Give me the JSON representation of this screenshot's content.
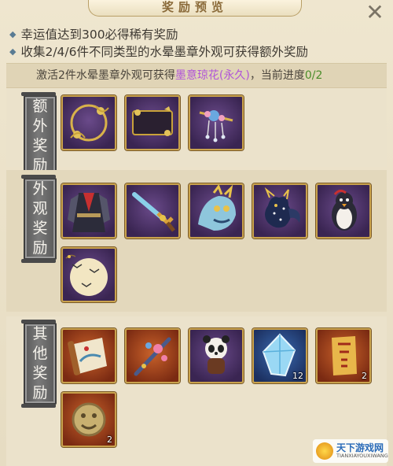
{
  "header": {
    "title": "奖励预览",
    "close_glyph": "✕"
  },
  "rules": [
    {
      "text": "幸运值达到300必得稀有奖励"
    },
    {
      "text": "收集2/4/6件不同类型的水晕墨章外观可获得额外奖励"
    }
  ],
  "progress": {
    "prefix": "激活2件水晕墨章外观可获得",
    "reward_name": "墨意琼花(永久)",
    "middle": "，当前进度",
    "current": "0",
    "separator": "/",
    "target": "2"
  },
  "sections": [
    {
      "label_chars": [
        "额",
        "外",
        "奖",
        "励"
      ],
      "items": [
        {
          "icon": "gold-floral-wreath-frame-icon",
          "bg": "purple"
        },
        {
          "icon": "ornate-gold-nameplate-frame-icon",
          "bg": "purple"
        },
        {
          "icon": "jeweled-hairpin-icon",
          "bg": "purple"
        }
      ]
    },
    {
      "label_chars": [
        "外",
        "观",
        "奖",
        "励"
      ],
      "items": [
        {
          "icon": "dark-robe-costume-icon",
          "bg": "purple"
        },
        {
          "icon": "ornate-sword-weapon-icon",
          "bg": "purple"
        },
        {
          "icon": "blue-gold-qilin-mount-icon",
          "bg": "purple"
        },
        {
          "icon": "starry-spirit-fox-pet-icon",
          "bg": "purple"
        },
        {
          "icon": "penguin-pet-icon",
          "bg": "purple"
        },
        {
          "icon": "moon-and-birds-background-icon",
          "bg": "purple"
        }
      ]
    },
    {
      "label_chars": [
        "其",
        "他",
        "奖",
        "励"
      ],
      "items": [
        {
          "icon": "painting-scroll-icon",
          "bg": "orange",
          "count": ""
        },
        {
          "icon": "flower-sword-icon",
          "bg": "orange",
          "count": ""
        },
        {
          "icon": "panda-companion-icon",
          "bg": "purple",
          "count": ""
        },
        {
          "icon": "blue-crystal-icon",
          "bg": "blue",
          "count": "12"
        },
        {
          "icon": "golden-talisman-scroll-icon",
          "bg": "orange",
          "count": "2"
        },
        {
          "icon": "gold-beast-token-icon",
          "bg": "orange",
          "count": "2"
        }
      ]
    }
  ],
  "watermark": {
    "name": "天下游戏网",
    "url": "TIANXIAYOUXIWANG"
  }
}
